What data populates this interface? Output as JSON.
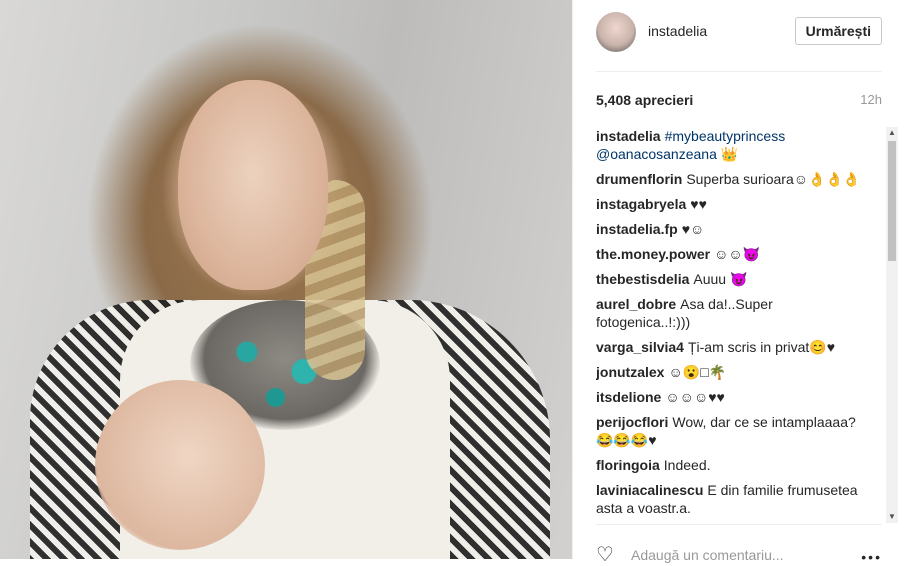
{
  "post": {
    "username": "instadelia",
    "follow_label": "Urmărești",
    "likes": "5,408 aprecieri",
    "time": "12h",
    "comments": [
      {
        "user": "instadelia",
        "text": "",
        "tags": "#mybeautyprincess @oanacosanzeana 👑"
      },
      {
        "user": "drumenflorin",
        "text": "Superba surioara☺👌👌👌",
        "tags": ""
      },
      {
        "user": "instagabryela",
        "text": "♥♥",
        "tags": ""
      },
      {
        "user": "instadelia.fp",
        "text": "♥☺",
        "tags": ""
      },
      {
        "user": "the.money.power",
        "text": "☺☺😈",
        "tags": ""
      },
      {
        "user": "thebestisdelia",
        "text": "Auuu 😈",
        "tags": ""
      },
      {
        "user": "aurel_dobre",
        "text": "Asa da!..Super fotogenica..!:)))",
        "tags": ""
      },
      {
        "user": "varga_silvia4",
        "text": "Ți-am scris in privat😊♥",
        "tags": ""
      },
      {
        "user": "jonutzalex",
        "text": "☺😮□🌴",
        "tags": ""
      },
      {
        "user": "itsdelione",
        "text": "☺☺☺♥♥",
        "tags": ""
      },
      {
        "user": "perijocflori",
        "text": "Wow, dar ce se intamplaaaa? 😂😂😂♥",
        "tags": ""
      },
      {
        "user": "floringoia",
        "text": "Indeed.",
        "tags": ""
      },
      {
        "user": "laviniacalinescu",
        "text": "E din familie frumusetea asta a voastr.a.",
        "tags": ""
      }
    ],
    "comment_placeholder": "Adaugă un comentariu...",
    "more_label": "•••"
  },
  "icons": {
    "heart": "heart-icon",
    "scroll_up": "chevron-up-icon",
    "scroll_down": "chevron-down-icon"
  }
}
